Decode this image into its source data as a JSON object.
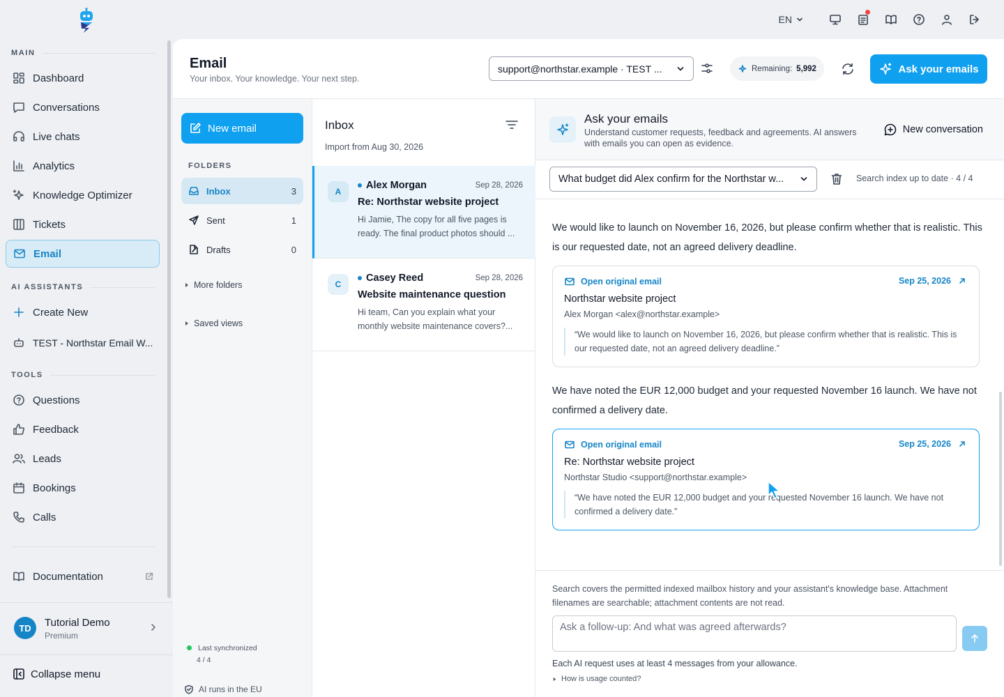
{
  "topbar": {
    "language": "EN"
  },
  "sidebar": {
    "section_main": "MAIN",
    "main_items": [
      {
        "label": "Dashboard",
        "icon": "dashboard-icon"
      },
      {
        "label": "Conversations",
        "icon": "chat-icon"
      },
      {
        "label": "Live chats",
        "icon": "headset-icon"
      },
      {
        "label": "Analytics",
        "icon": "bar-chart-icon"
      },
      {
        "label": "Knowledge Optimizer",
        "icon": "sparkles-icon"
      },
      {
        "label": "Tickets",
        "icon": "columns-icon"
      },
      {
        "label": "Email",
        "icon": "mail-icon",
        "active": true
      }
    ],
    "section_ai": "AI ASSISTANTS",
    "ai_items": [
      {
        "label": "Create New",
        "icon": "plus-icon"
      },
      {
        "label": "TEST - Northstar Email W...",
        "icon": "bot-icon"
      }
    ],
    "section_tools": "TOOLS",
    "tools_items": [
      {
        "label": "Questions",
        "icon": "question-icon"
      },
      {
        "label": "Feedback",
        "icon": "thumbs-up-icon"
      },
      {
        "label": "Leads",
        "icon": "users-icon"
      },
      {
        "label": "Bookings",
        "icon": "calendar-icon"
      },
      {
        "label": "Calls",
        "icon": "phone-icon"
      }
    ],
    "documentation": "Documentation",
    "user": {
      "initials": "TD",
      "name": "Tutorial Demo",
      "plan": "Premium"
    },
    "collapse": "Collapse menu"
  },
  "header": {
    "title": "Email",
    "subtitle": "Your inbox. Your knowledge. Your next step.",
    "account": "support@northstar.example · TEST ...",
    "remaining_label": "Remaining:",
    "remaining_value": "5,992",
    "ask_button": "Ask your emails"
  },
  "folders": {
    "new_email": "New email",
    "label": "FOLDERS",
    "items": [
      {
        "name": "Inbox",
        "count": "3",
        "active": true
      },
      {
        "name": "Sent",
        "count": "1"
      },
      {
        "name": "Drafts",
        "count": "0"
      }
    ],
    "more": "More folders",
    "saved": "Saved views",
    "sync_label": "Last synchronized",
    "sync_value": "4 / 4",
    "eu": "AI runs in the EU"
  },
  "inbox": {
    "title": "Inbox",
    "import_from": "Import from Aug 30, 2026",
    "messages": [
      {
        "initial": "A",
        "from": "Alex Morgan",
        "date": "Sep 28, 2026",
        "subject": "Re: Northstar website project",
        "preview": "Hi Jamie, The copy for all five pages is ready. The final product photos should ..."
      },
      {
        "initial": "C",
        "from": "Casey Reed",
        "date": "Sep 28, 2026",
        "subject": "Website maintenance question",
        "preview": "Hi team, Can you explain what your monthly website maintenance covers?..."
      }
    ]
  },
  "ask": {
    "title": "Ask your emails",
    "description": "Understand customer requests, feedback and agreements. AI answers with emails you can open as evidence.",
    "new_conversation": "New conversation",
    "question": "What budget did Alex confirm for the Northstar w...",
    "index_status": "Search index up to date · 4 / 4",
    "answer_1": "We would like to launch on November 16, 2026, but please confirm whether that is realistic. This is our requested date, not an agreed delivery deadline.",
    "source_1": {
      "open": "Open original email",
      "date": "Sep 25, 2026",
      "title": "Northstar website project",
      "from": "Alex Morgan <alex@northstar.example>",
      "quote": "“We would like to launch on November 16, 2026, but please confirm whether that is realistic. This is our requested date, not an agreed delivery deadline.”"
    },
    "answer_2": "We have noted the EUR 12,000 budget and your requested November 16 launch. We have not confirmed a delivery date.",
    "source_2": {
      "open": "Open original email",
      "date": "Sep 25, 2026",
      "title": "Re: Northstar website project",
      "from": "Northstar Studio <support@northstar.example>",
      "quote": "“We have noted the EUR 12,000 budget and your requested November 16 launch. We have not confirmed a delivery date.”"
    },
    "scope_note": "Search covers the permitted indexed mailbox history and your assistant's knowledge base. Attachment filenames are searchable; attachment contents are not read.",
    "input_placeholder": "Ask a follow-up: And what was agreed afterwards?",
    "allowance": "Each AI request uses at least 4 messages from your allowance.",
    "usage_link": "How is usage counted?"
  },
  "colors": {
    "accent": "#10a0f0",
    "accent_dark": "#1685c7",
    "active_bg": "#d8ecf7",
    "notification": "#ef4444",
    "online": "#22c55e"
  }
}
